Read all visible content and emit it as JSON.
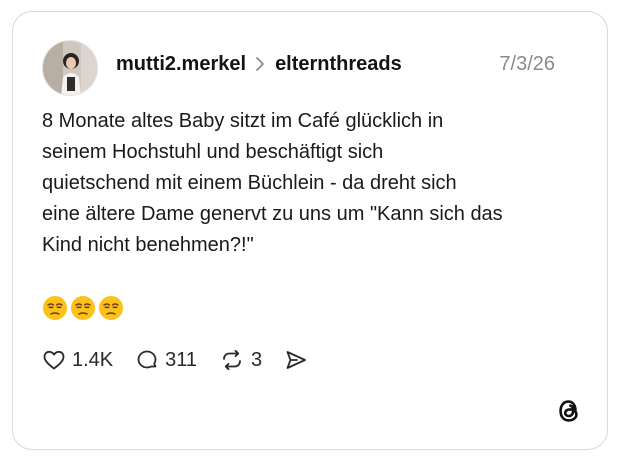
{
  "post": {
    "username": "mutti2.merkel",
    "community": "elternthreads",
    "date": "7/3/26",
    "text": "8 Monate altes Baby sitzt im Café glücklich in\nseinem Hochstuhl und beschäftigt sich\nquietschend mit einem Büchlein - da dreht sich\neine ältere Dame genervt zu uns um \"Kann sich das\nKind nicht benehmen?!\"",
    "emojis": [
      "😒",
      "😒",
      "😒"
    ],
    "likes": "1.4K",
    "replies": "311",
    "reposts": "3"
  },
  "icons": {
    "like": "heart-icon",
    "reply": "speech-bubble-icon",
    "repost": "repost-icon",
    "share": "send-icon",
    "brand": "threads-logo-icon",
    "separator": "chevron-right-icon"
  },
  "colors": {
    "border": "#d9d9d9",
    "date": "#8b8b8b",
    "text": "#1a1a1a"
  }
}
